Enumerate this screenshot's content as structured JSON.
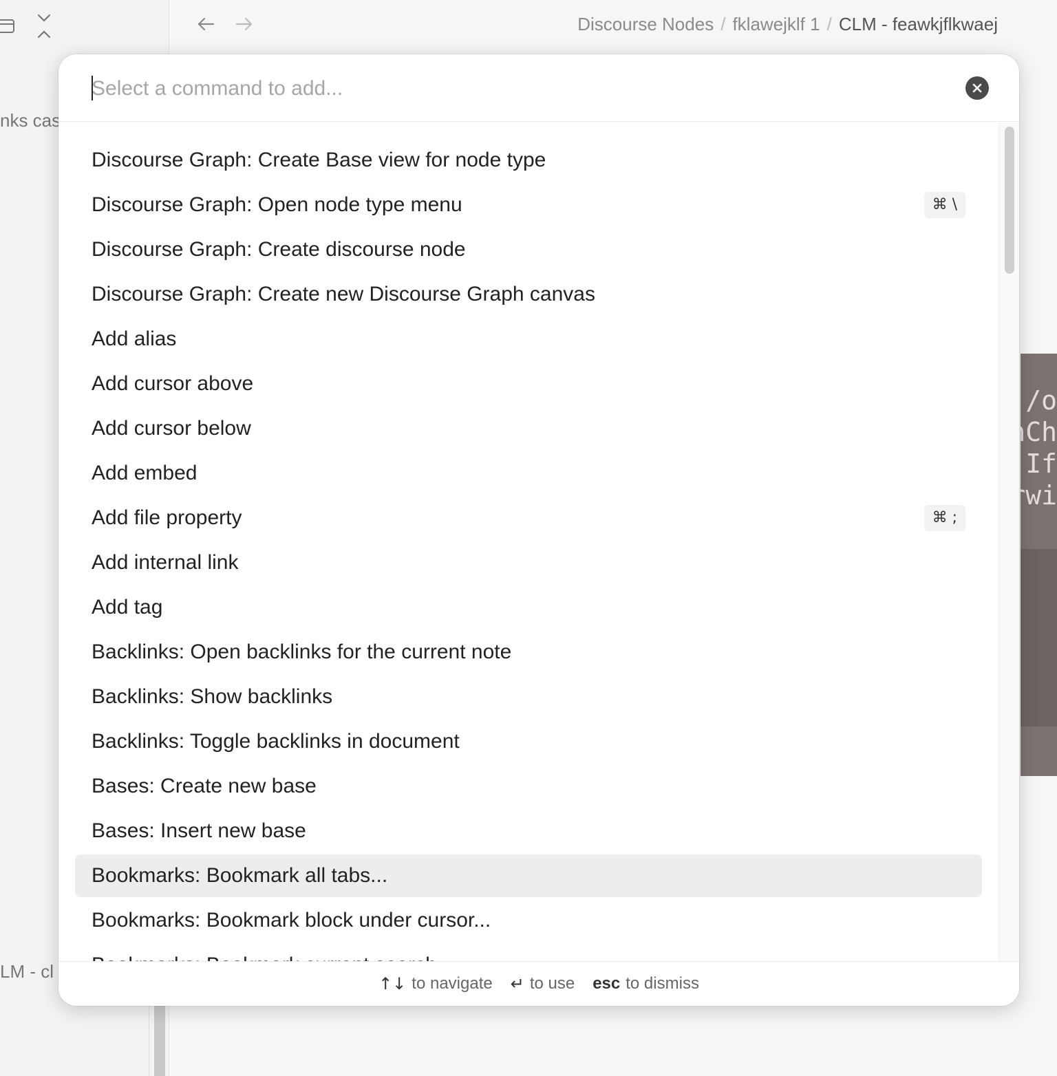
{
  "background": {
    "left_snippets": [
      "nks cas",
      "LM - cl"
    ],
    "breadcrumb": [
      "Discourse Nodes",
      "fklawejklf 1",
      "CLM - feawkjflkwaej"
    ],
    "breadcrumb_separator": "/",
    "code_fragments": [
      "/o",
      "nCh",
      "If",
      "rwi"
    ]
  },
  "modal": {
    "search_placeholder": "Select a command to add...",
    "search_value": "",
    "commands": [
      {
        "label": "Discourse Graph: Create Base view for node type",
        "hotkey": ""
      },
      {
        "label": "Discourse Graph: Open node type menu",
        "hotkey": "⌘ \\"
      },
      {
        "label": "Discourse Graph: Create discourse node",
        "hotkey": ""
      },
      {
        "label": "Discourse Graph: Create new Discourse Graph canvas",
        "hotkey": ""
      },
      {
        "label": "Add alias",
        "hotkey": ""
      },
      {
        "label": "Add cursor above",
        "hotkey": ""
      },
      {
        "label": "Add cursor below",
        "hotkey": ""
      },
      {
        "label": "Add embed",
        "hotkey": ""
      },
      {
        "label": "Add file property",
        "hotkey": "⌘ ;"
      },
      {
        "label": "Add internal link",
        "hotkey": ""
      },
      {
        "label": "Add tag",
        "hotkey": ""
      },
      {
        "label": "Backlinks: Open backlinks for the current note",
        "hotkey": ""
      },
      {
        "label": "Backlinks: Show backlinks",
        "hotkey": ""
      },
      {
        "label": "Backlinks: Toggle backlinks in document",
        "hotkey": ""
      },
      {
        "label": "Bases: Create new base",
        "hotkey": ""
      },
      {
        "label": "Bases: Insert new base",
        "hotkey": ""
      },
      {
        "label": "Bookmarks: Bookmark all tabs...",
        "hotkey": "",
        "selected": true
      },
      {
        "label": "Bookmarks: Bookmark block under cursor...",
        "hotkey": ""
      },
      {
        "label": "Bookmarks: Bookmark current search...",
        "hotkey": ""
      }
    ],
    "footer": {
      "navigate_keys": "↑↓",
      "navigate_label": "to navigate",
      "use_key": "↵",
      "use_label": "to use",
      "dismiss_key": "esc",
      "dismiss_label": "to dismiss"
    }
  },
  "colors": {
    "selected_row": "#ededed",
    "clear_button": "#4a4a4a",
    "placeholder": "#a6a6a6"
  }
}
